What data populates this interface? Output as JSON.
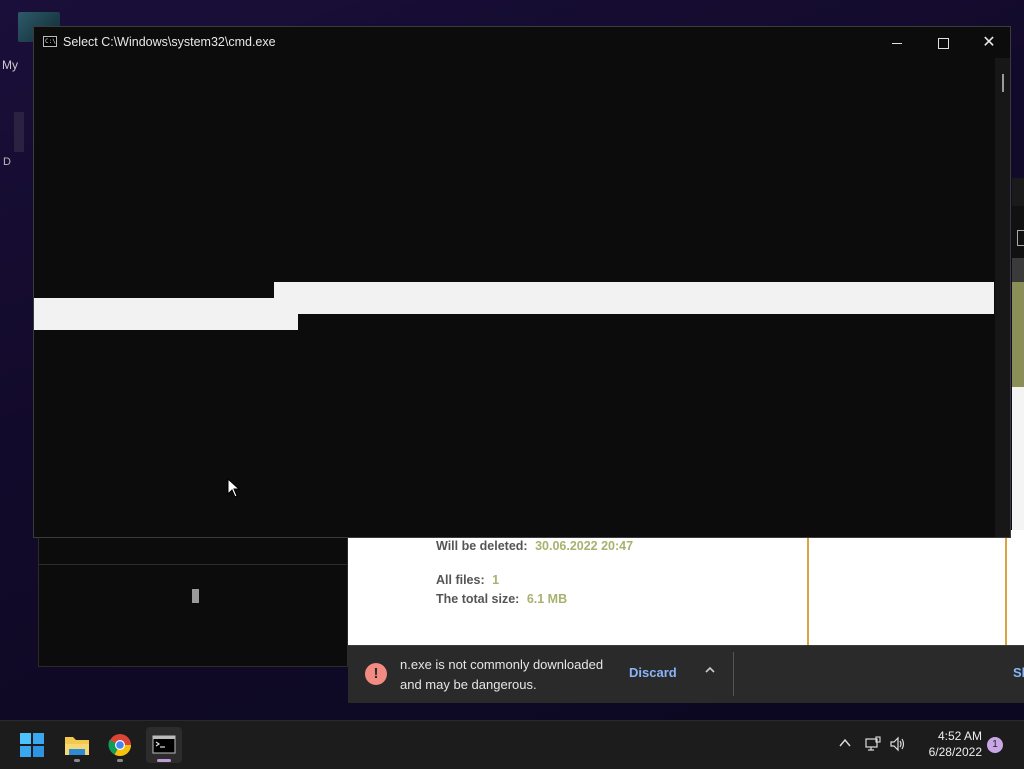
{
  "desktop": {
    "icon_label": "My",
    "icon2_label": "D"
  },
  "cmd_window": {
    "title": "Select C:\\Windows\\system32\\cmd.exe",
    "icon_text": "C:\\",
    "minimize_glyph": "—",
    "close_glyph": "✕"
  },
  "background_page": {
    "will_be_deleted_label": "Will be deleted:",
    "will_be_deleted_value": "30.06.2022 20:47",
    "all_files_label": "All files:",
    "all_files_value": "1",
    "total_size_label": "The total size:",
    "total_size_value": "6.1 MB"
  },
  "download_bar": {
    "warning_text": "n.exe is not commonly downloaded and may be dangerous.",
    "discard_label": "Discard",
    "expand_glyph": "^",
    "show_all_label": "Sh"
  },
  "taskbar": {
    "apps": [
      {
        "name": "Start",
        "icon": "windows-logo-icon"
      },
      {
        "name": "File Explorer",
        "icon": "folder-icon"
      },
      {
        "name": "Google Chrome",
        "icon": "chrome-icon"
      },
      {
        "name": "Command Prompt",
        "icon": "terminal-icon",
        "active": true
      }
    ],
    "tray_chevron": "^",
    "time": "4:52 AM",
    "date": "6/28/2022",
    "notification_count": "1"
  },
  "colors": {
    "accent_download_link": "#8ab4f8",
    "warning_red": "#f28b82",
    "value_olive": "#a9b16e",
    "active_indicator": "#c19ad9"
  }
}
